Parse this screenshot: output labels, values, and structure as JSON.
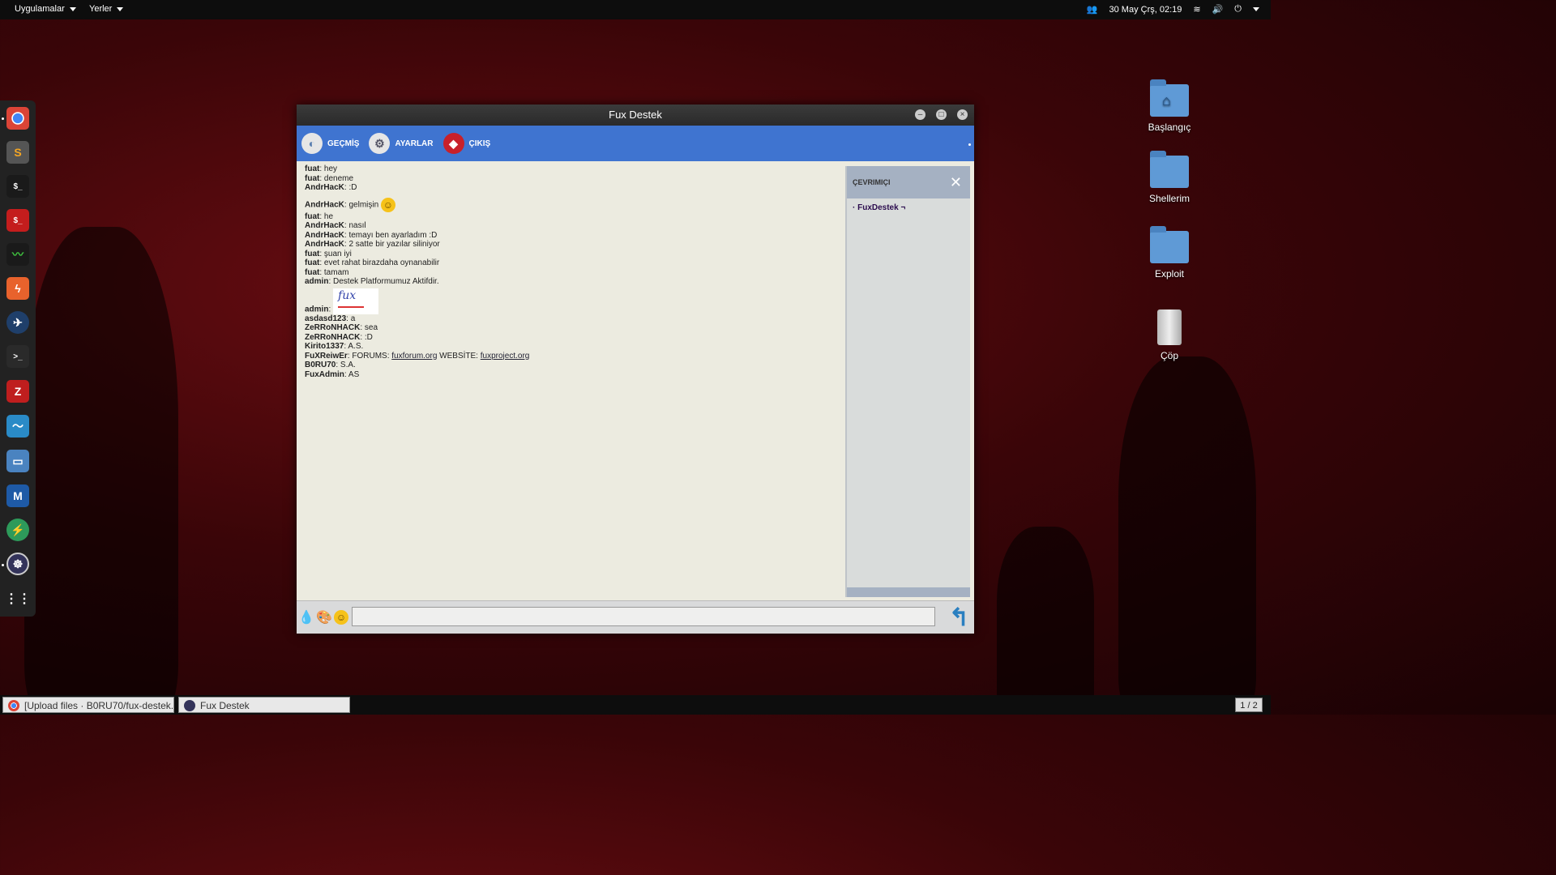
{
  "topbar": {
    "apps_label": "Uygulamalar",
    "places_label": "Yerler",
    "datetime": "30 May Çrş, 02:19"
  },
  "dock": {
    "items": [
      "chrome-icon",
      "sublime-icon",
      "terminal-icon",
      "red-terminal-icon",
      "system-monitor-icon",
      "burp-icon",
      "zenmap-icon",
      "terminal-dark-icon",
      "filezilla-icon",
      "wireshark-icon",
      "files-icon",
      "malwarebytes-icon",
      "lightning-icon",
      "fux-app-icon",
      "app-grid-icon"
    ]
  },
  "desktop": {
    "icons": [
      {
        "label": "Başlangıç"
      },
      {
        "label": "Shellerim"
      },
      {
        "label": "Exploit"
      },
      {
        "label": "Çöp"
      }
    ]
  },
  "window": {
    "title": "Fux Destek",
    "toolbar": {
      "history": "GEÇMİŞ",
      "settings": "AYARLAR",
      "exit": "ÇIKIŞ"
    },
    "chat": [
      {
        "user": "fuat",
        "text": "hey"
      },
      {
        "user": "fuat",
        "text": "deneme"
      },
      {
        "user": "AndrHacK",
        "text": ":D"
      },
      {
        "user": "AndrHacK",
        "text": "gelmişin"
      },
      {
        "user": "fuat",
        "text": "he"
      },
      {
        "user": "AndrHacK",
        "text": "nasıl"
      },
      {
        "user": "AndrHacK",
        "text": "temayı ben ayarladım :D"
      },
      {
        "user": "AndrHacK",
        "text": "2 satte bir yazılar siliniyor"
      },
      {
        "user": "fuat",
        "text": "şuan iyi"
      },
      {
        "user": "fuat",
        "text": "evet rahat birazdaha oynanabilir"
      },
      {
        "user": "fuat",
        "text": "tamam"
      },
      {
        "user": "admin",
        "text": "Destek Platformumuz Aktifdir."
      },
      {
        "user": "admin",
        "text": ""
      },
      {
        "user": "asdasd123",
        "text": "a"
      },
      {
        "user": "ZeRRoNHACK",
        "text": "sea"
      },
      {
        "user": "ZeRRoNHACK",
        "text": ":D"
      },
      {
        "user": "Kirito1337",
        "text": "A.S."
      },
      {
        "user": "FuXReiwEr",
        "text": "FORUMS:"
      },
      {
        "user": "B0RU70",
        "text": "S.A."
      },
      {
        "user": "FuxAdmin",
        "text": "AS"
      }
    ],
    "links": {
      "forum": "fuxforum.org",
      "website_label": "WEBSİTE:",
      "website": "fuxproject.org"
    },
    "fux_image_text": "fux",
    "online": {
      "header": "ÇEVRIMIÇI",
      "users": [
        "· FuxDestek ¬"
      ]
    },
    "input": {
      "value": "",
      "placeholder": ""
    }
  },
  "taskbar": {
    "tasks": [
      "[Upload files · B0RU70/fux-destek...",
      "Fux Destek"
    ],
    "pager": "1 / 2"
  }
}
